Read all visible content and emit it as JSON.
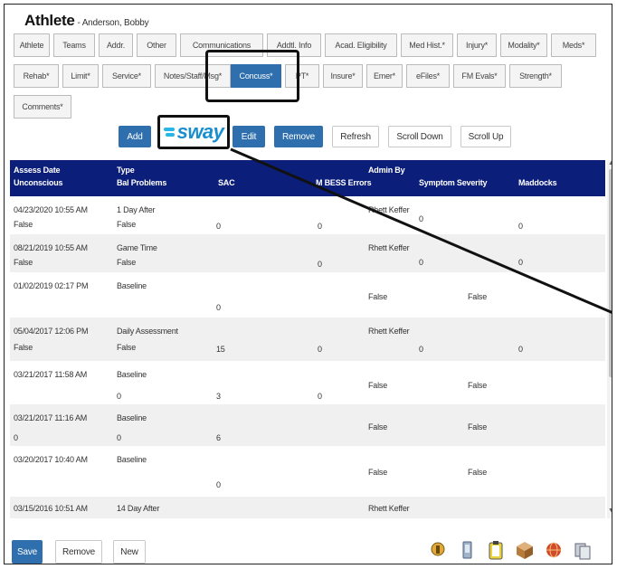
{
  "header": {
    "title": "Athlete",
    "subtitle": "- Anderson, Bobby"
  },
  "tabs": {
    "row1": [
      "Athlete",
      "Teams",
      "Addr.",
      "Other",
      "Communications",
      "Addtl. Info",
      "Acad. Eligibility",
      "Med Hist.*",
      "Injury*",
      "Modality*",
      "Meds*"
    ],
    "row2": [
      "Rehab*",
      "Limit*",
      "Service*",
      "Notes/Staff/Msg*",
      "Concuss*",
      "PT*",
      "Insure*",
      "Emer*",
      "eFiles*",
      "FM Evals*",
      "Strength*"
    ],
    "row3": [
      "Comments*"
    ],
    "active": "Concuss*"
  },
  "toolbar": {
    "add": "Add",
    "sway": "sway",
    "edit": "Edit",
    "remove": "Remove",
    "refresh": "Refresh",
    "scroll_down": "Scroll Down",
    "scroll_up": "Scroll Up"
  },
  "table": {
    "headers": {
      "assess_date": "Assess Date",
      "unconscious": "Unconscious",
      "type": "Type",
      "bal_problems": "Bal Problems",
      "sac": "SAC",
      "admin_by": "Admin By",
      "bess": "M BESS Errors",
      "symptom": "Symptom Severity",
      "maddocks": "Maddocks"
    },
    "rows": [
      {
        "date": "04/23/2020 10:55 AM",
        "type": "1 Day After",
        "admin": "Rhett Keffer",
        "unconscious": "False",
        "bal": "False",
        "sac": "0",
        "bess": "0",
        "symptom": "0",
        "maddocks": "0"
      },
      {
        "date": "08/21/2019 10:55 AM",
        "type": "Game Time",
        "admin": "Rhett Keffer",
        "unconscious": "False",
        "bal": "False",
        "sac": "",
        "bess": "0",
        "symptom": "0",
        "maddocks": "0"
      },
      {
        "date": "01/02/2019 02:17 PM",
        "type": "Baseline",
        "admin": "",
        "unconscious": "",
        "bal": "",
        "sac": "0",
        "bess": "",
        "symptom": "False",
        "maddocks": "False"
      },
      {
        "date": "05/04/2017 12:06 PM",
        "type": "Daily Assessment",
        "admin": "Rhett Keffer",
        "unconscious": "False",
        "bal": "False",
        "sac": "15",
        "bess": "0",
        "symptom": "0",
        "maddocks": "0"
      },
      {
        "date": "03/21/2017 11:58 AM",
        "type": "Baseline",
        "admin": "",
        "unconscious": "",
        "bal": "0",
        "sac": "3",
        "bess": "0",
        "symptom": "False",
        "maddocks": "False"
      },
      {
        "date": "03/21/2017 11:16 AM",
        "type": "Baseline",
        "admin": "",
        "unconscious": "0",
        "bal": "0",
        "sac": "6",
        "bess": "",
        "symptom": "False",
        "maddocks": "False"
      },
      {
        "date": "03/20/2017 10:40 AM",
        "type": "Baseline",
        "admin": "",
        "unconscious": "",
        "bal": "",
        "sac": "0",
        "bess": "",
        "symptom": "False",
        "maddocks": "False"
      },
      {
        "date": "03/15/2016 10:51 AM",
        "type": "14 Day After",
        "admin": "Rhett Keffer",
        "unconscious": "",
        "bal": "",
        "sac": "",
        "bess": "",
        "symptom": "",
        "maddocks": ""
      }
    ]
  },
  "bottom": {
    "save": "Save",
    "remove": "Remove",
    "new": "New"
  },
  "icons": [
    "key-icon",
    "device-icon",
    "clipboard-icon",
    "box-icon",
    "globe-icon",
    "copy-icon"
  ],
  "colors": {
    "accent": "#2f6fae",
    "header": "#0b1e7a",
    "sway": "#1a8fd0"
  }
}
